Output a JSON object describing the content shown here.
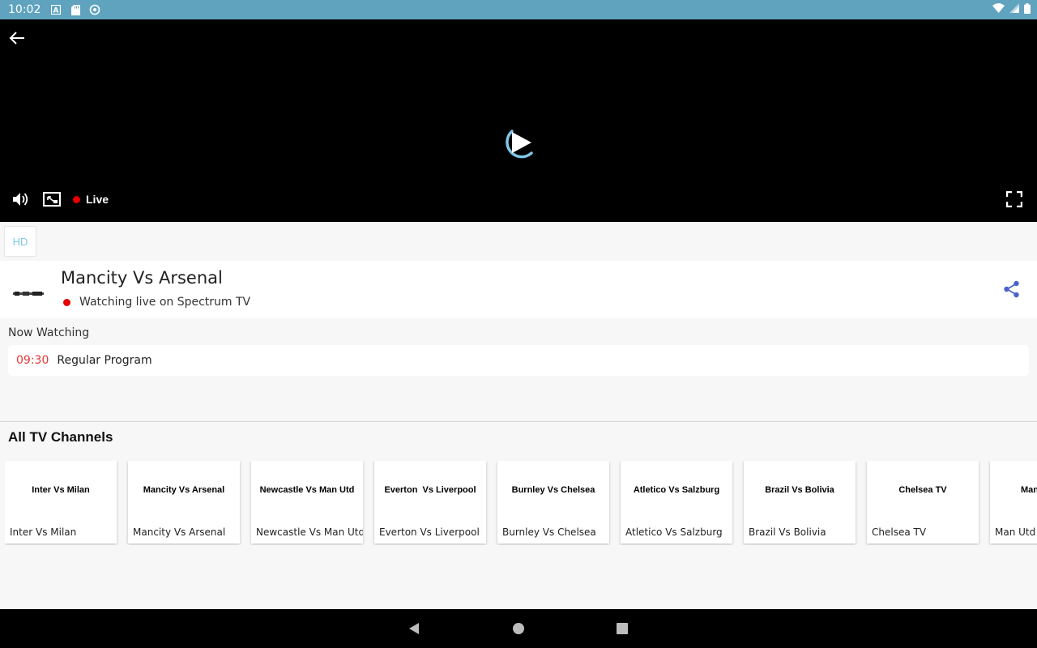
{
  "status_bar": {
    "time": "10:02",
    "icons": [
      "a-notification-icon",
      "sd-card-icon",
      "sync-icon"
    ],
    "right_icons": [
      "wifi-icon",
      "signal-icon",
      "battery-icon"
    ]
  },
  "player": {
    "live_label": "Live",
    "accent_color": "#7fc7e6",
    "live_color": "#e60000"
  },
  "quality": {
    "selected": "HD"
  },
  "channel": {
    "title": "Mancity Vs Arsenal",
    "live_status": "Watching live on Spectrum TV"
  },
  "now_watching": {
    "label": "Now Watching",
    "program": {
      "time": "09:30",
      "title": "Regular Program"
    }
  },
  "all_channels": {
    "title": "All TV Channels",
    "items": [
      {
        "thumb": "Inter Vs Milan",
        "name": "Inter Vs Milan"
      },
      {
        "thumb": "Mancity Vs Arsenal",
        "name": "Mancity Vs Arsenal"
      },
      {
        "thumb": "Newcastle Vs Man Utd",
        "name": "Newcastle Vs Man Utd"
      },
      {
        "thumb": "Everton  Vs Liverpool",
        "name": "Everton Vs Liverpool"
      },
      {
        "thumb": "Burnley Vs Chelsea",
        "name": "Burnley Vs Chelsea"
      },
      {
        "thumb": "Atletico Vs Salzburg",
        "name": "Atletico Vs Salzburg"
      },
      {
        "thumb": "Brazil Vs Bolivia",
        "name": "Brazil Vs Bolivia"
      },
      {
        "thumb": "Chelsea TV",
        "name": "Chelsea TV"
      },
      {
        "thumb": "Man",
        "name": "Man Utd T"
      }
    ]
  }
}
